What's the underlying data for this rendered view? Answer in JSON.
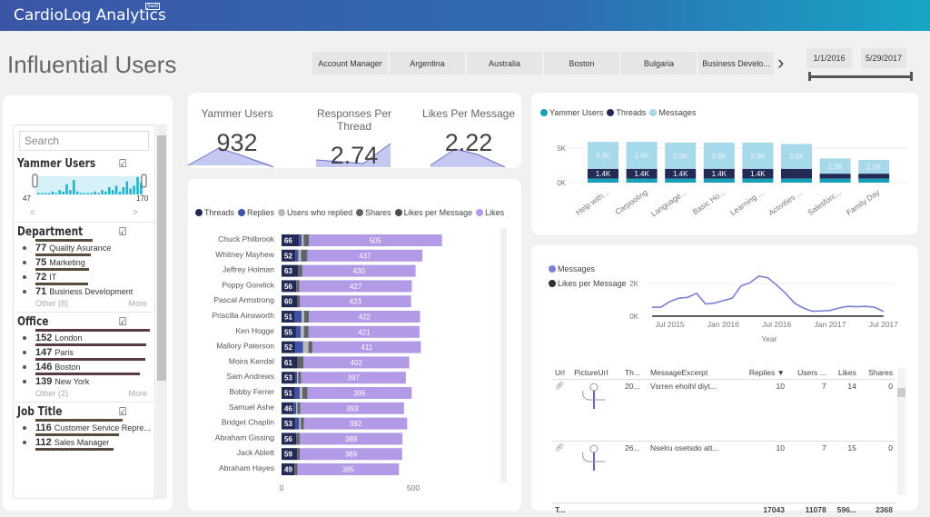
{
  "app": {
    "name": "CardioLog Analytics",
    "badge": "SaaS"
  },
  "page_title": "Influential Users",
  "filter_chips": [
    "Account Manager",
    "Argentina",
    "Australia",
    "Boston",
    "Bulgaria",
    "Business Develo..."
  ],
  "date_range": {
    "start": "1/1/2016",
    "end": "5/29/2017"
  },
  "slicer": {
    "search_placeholder": "Search",
    "yammer_users": {
      "title": "Yammer Users",
      "min": "47",
      "max": "170",
      "prev": "<",
      "next": ">"
    },
    "department": {
      "title": "Department",
      "items": [
        {
          "count": "77",
          "label": "Quality Asurance"
        },
        {
          "count": "75",
          "label": "Marketing"
        },
        {
          "count": "72",
          "label": "IT"
        },
        {
          "count": "71",
          "label": "Business Development"
        }
      ],
      "other": "Other (8)",
      "more": "More"
    },
    "office": {
      "title": "Office",
      "items": [
        {
          "count": "152",
          "label": "London"
        },
        {
          "count": "147",
          "label": "Paris"
        },
        {
          "count": "146",
          "label": "Boston"
        },
        {
          "count": "139",
          "label": "New York"
        }
      ],
      "other": "Other (2)",
      "more": "More"
    },
    "job_title": {
      "title": "Job Title",
      "items": [
        {
          "count": "116",
          "label": "Customer Service Repre..."
        },
        {
          "count": "112",
          "label": "Sales Manager"
        }
      ]
    }
  },
  "kpis": [
    {
      "label": "Yammer Users",
      "value": "932"
    },
    {
      "label": "Responses Per Thread",
      "value": "2.74"
    },
    {
      "label": "Likes Per Message",
      "value": "2.22"
    }
  ],
  "colors": {
    "threads": "#232a55",
    "replies": "#3f51a8",
    "users_replied": "#b9b9b9",
    "shares": "#5f6468",
    "likes_per_message": "#4a4f53",
    "likes": "#b39ae6",
    "yammer_users": "#1a9fb8",
    "messages": "#a6daea",
    "line_messages": "#7b7fd4"
  },
  "chart_data": [
    {
      "type": "bar",
      "orientation": "horizontal",
      "stacked": true,
      "legend": [
        "Threads",
        "Replies",
        "Users who replied",
        "Shares",
        "Likes per Message",
        "Likes"
      ],
      "categories": [
        "Chuck Philbrook",
        "Whitney Mayhew",
        "Jeffrey Holman",
        "Poppy Gorelick",
        "Pascal Armstrong",
        "Priscilla Ainsworth",
        "Ken Hogge",
        "Mallory Paterson",
        "Moira Kendal",
        "Sam Andrews",
        "Bobby Ferrer",
        "Samuel Ashe",
        "Bridget Chaplin",
        "Abraham Gissing",
        "Jack Ablett",
        "Abraham Hayes"
      ],
      "series": [
        {
          "name": "Threads",
          "values": [
            66,
            52,
            63,
            56,
            60,
            51,
            55,
            52,
            61,
            53,
            51,
            46,
            53,
            56,
            59,
            49
          ]
        },
        {
          "name": "Replies",
          "values": [
            10,
            12,
            0,
            0,
            0,
            25,
            18,
            30,
            0,
            6,
            18,
            10,
            14,
            0,
            0,
            0
          ]
        },
        {
          "name": "Users who replied",
          "values": [
            8,
            10,
            0,
            0,
            0,
            10,
            12,
            20,
            0,
            4,
            10,
            4,
            6,
            0,
            0,
            0
          ]
        },
        {
          "name": "Shares",
          "values": [
            18,
            22,
            14,
            10,
            7,
            16,
            16,
            14,
            20,
            10,
            18,
            10,
            10,
            12,
            8,
            10
          ]
        },
        {
          "name": "Likes per Message",
          "values": [
            2,
            2,
            2,
            2,
            2,
            2,
            2,
            2,
            2,
            2,
            2,
            2,
            2,
            2,
            2,
            2
          ]
        },
        {
          "name": "Likes",
          "values": [
            505,
            437,
            430,
            427,
            423,
            422,
            421,
            411,
            402,
            397,
            395,
            393,
            392,
            389,
            389,
            385
          ]
        }
      ],
      "xticks": [
        "0",
        "500"
      ],
      "xlim": [
        0,
        850
      ],
      "legend_position": "top"
    },
    {
      "type": "bar",
      "stacked": true,
      "legend": [
        "Yammer Users",
        "Threads",
        "Messages"
      ],
      "categories": [
        "Help with...",
        "Carpooling",
        "Language...",
        "Basic Ho...",
        "Learning ...",
        "Activities ...",
        "Salesforc...",
        "Family Day"
      ],
      "series": [
        {
          "name": "Yammer Users",
          "values": [
            0.6,
            0.6,
            0.6,
            0.6,
            0.6,
            0.6,
            0.6,
            0.6
          ]
        },
        {
          "name": "Threads",
          "values": [
            1.4,
            1.4,
            1.4,
            1.4,
            1.4,
            1.4,
            0.7,
            0.7
          ]
        },
        {
          "name": "Messages",
          "values": [
            3.9,
            3.9,
            3.8,
            3.8,
            3.8,
            3.6,
            2.2,
            2.0
          ]
        }
      ],
      "data_labels": {
        "Threads": [
          "1.4K",
          "1.4K",
          "1.4K",
          "1.4K",
          "1.4K",
          "",
          "",
          ""
        ],
        "Messages": [
          "3.9K",
          "3.9K",
          "3.8K",
          "3.8K",
          "3.8K",
          "3.6K",
          "2.2K",
          "2.0K"
        ]
      },
      "yticks": [
        "0K",
        "5K"
      ],
      "ylim": [
        0,
        6.5
      ],
      "unit": "K",
      "legend_position": "top-left"
    },
    {
      "type": "line",
      "legend": [
        "Messages",
        "Likes per Message"
      ],
      "xlabel": "Year",
      "xticks": [
        "Jul 2015",
        "Jan 2016",
        "Jul 2016",
        "Jan 2017",
        "Jul 2017"
      ],
      "x": [
        "2015-05",
        "2015-06",
        "2015-07",
        "2015-08",
        "2015-09",
        "2015-10",
        "2015-11",
        "2015-12",
        "2016-01",
        "2016-02",
        "2016-03",
        "2016-04",
        "2016-05",
        "2016-06",
        "2016-07",
        "2016-08",
        "2016-09",
        "2016-10",
        "2016-11",
        "2016-12",
        "2017-01",
        "2017-02",
        "2017-03",
        "2017-04",
        "2017-05",
        "2017-06",
        "2017-07"
      ],
      "series": [
        {
          "name": "Messages",
          "values": [
            0.55,
            0.55,
            0.9,
            1.1,
            1.15,
            1.4,
            0.75,
            0.8,
            0.95,
            1.1,
            1.85,
            2.05,
            2.45,
            2.35,
            1.9,
            1.4,
            0.8,
            0.5,
            0.3,
            0.32,
            0.35,
            0.5,
            0.6,
            0.58,
            0.6,
            0.55,
            0.3
          ]
        },
        {
          "name": "Likes per Message",
          "values": [
            0.002,
            0.002,
            0.002,
            0.002,
            0.002,
            0.002,
            0.002,
            0.002,
            0.002,
            0.002,
            0.002,
            0.002,
            0.002,
            0.002,
            0.002,
            0.002,
            0.002,
            0.002,
            0.002,
            0.002,
            0.002,
            0.002,
            0.002,
            0.002,
            0.002,
            0.002,
            0.002
          ]
        }
      ],
      "yticks": [
        "0K",
        "2K"
      ],
      "ylim": [
        0,
        2.7
      ],
      "unit": "K",
      "legend_position": "left"
    }
  ],
  "table": {
    "columns": [
      "Url",
      "PictureUrl",
      "Th...",
      "MessageExcerpt",
      "Replies",
      "Users ...",
      "Likes",
      "Shares"
    ],
    "rows": [
      [
        "link-icon",
        "picture",
        "20...",
        "Vsrren ehoihl diyt...",
        "10",
        "7",
        "14",
        "0"
      ],
      [
        "link-icon",
        "picture",
        "26...",
        "Nselru osetsdo att...",
        "10",
        "7",
        "15",
        "0"
      ]
    ],
    "total": [
      "T...",
      "",
      "",
      "",
      "17043",
      "11078",
      "596...",
      "2368"
    ]
  }
}
